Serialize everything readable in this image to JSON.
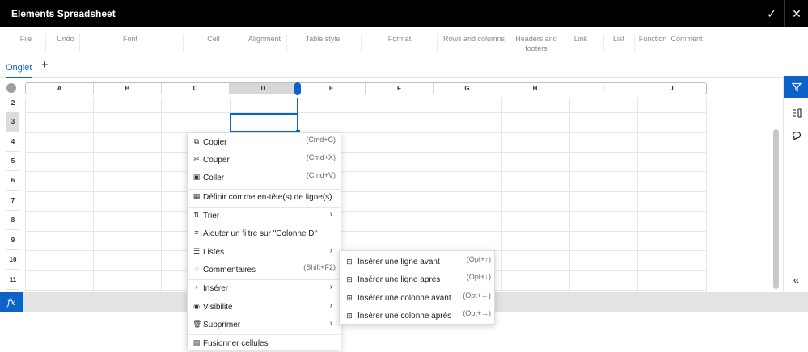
{
  "window": {
    "title": "Elements Spreadsheet",
    "ok_glyph": "✓",
    "close_glyph": "✕"
  },
  "ribbon": [
    "File",
    "Undo",
    "Font",
    "Cell",
    "Alignment",
    "Table style",
    "Format",
    "Rows and columns",
    "Headers and footers",
    "Link",
    "List",
    "Function",
    "Comment"
  ],
  "tabs": {
    "active": "Onglet",
    "add_glyph": "+"
  },
  "grid": {
    "columns": [
      "A",
      "B",
      "C",
      "D",
      "E",
      "F",
      "G",
      "H",
      "I",
      "J"
    ],
    "selected_column": "D",
    "rows": [
      "2",
      "3",
      "4",
      "5",
      "6",
      "7",
      "8",
      "9",
      "10",
      "11"
    ],
    "selected_row": "3"
  },
  "formula_bar": {
    "fx_label": "fx"
  },
  "sidebar": {
    "collapse_glyph": "«"
  },
  "context_menu": {
    "items": [
      {
        "label": "Copier",
        "shortcut": "(Cmd+C)",
        "icon": "copy-icon"
      },
      {
        "label": "Couper",
        "shortcut": "(Cmd+X)",
        "icon": "cut-icon"
      },
      {
        "label": "Coller",
        "shortcut": "(Cmd+V)",
        "icon": "paste-icon"
      },
      {
        "label": "Définir comme en-tête(s) de ligne(s)",
        "icon": "table-header-icon"
      },
      {
        "label": "Trier",
        "icon": "sort-icon",
        "submenu": true
      },
      {
        "label": "Ajouter un filtre sur \"Colonne D\"",
        "icon": "filter-icon"
      },
      {
        "label": "Listes",
        "icon": "list-icon",
        "submenu": true
      },
      {
        "label": "Commentaires",
        "shortcut": "(Shift+F2)",
        "icon": "comment-icon"
      },
      {
        "label": "Insérer",
        "icon": "insert-icon",
        "submenu": true
      },
      {
        "label": "Visibilité",
        "icon": "eye-icon",
        "submenu": true
      },
      {
        "label": "Supprimer",
        "icon": "trash-icon",
        "submenu": true
      },
      {
        "label": "Fusionner cellules",
        "icon": "merge-icon"
      }
    ]
  },
  "insert_submenu": {
    "items": [
      {
        "label": "Insérer une ligne avant",
        "shortcut": "(Opt+↑)",
        "icon": "insert-row-above-icon"
      },
      {
        "label": "Insérer une ligne après",
        "shortcut": "(Opt+↓)",
        "icon": "insert-row-below-icon"
      },
      {
        "label": "Insérer une colonne avant",
        "shortcut": "(Opt+←)",
        "icon": "insert-column-left-icon"
      },
      {
        "label": "Insérer une colonne après",
        "shortcut": "(Opt+→)",
        "icon": "insert-column-right-icon"
      }
    ]
  },
  "colors": {
    "accent": "#0b63c9",
    "titlebar": "#000000"
  }
}
